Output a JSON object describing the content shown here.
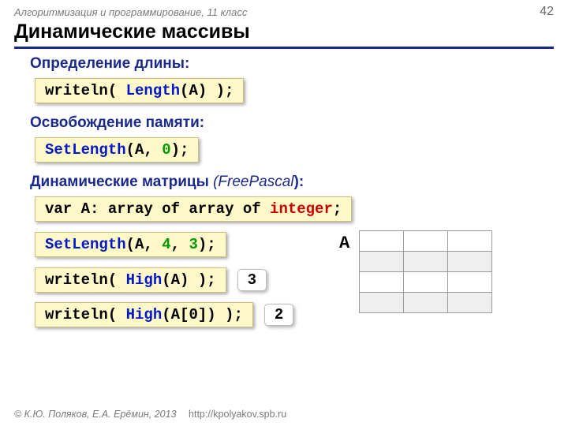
{
  "header": {
    "course": "Алгоритмизация и программирование, 11 класс",
    "page": "42"
  },
  "title": "Динамические массивы",
  "sections": {
    "s1": {
      "heading": "Определение длины:",
      "code": {
        "a": "writeln( ",
        "b": "Length",
        "c": "(A) );"
      }
    },
    "s2": {
      "heading": "Освобождение памяти:",
      "code": {
        "a": "SetLength",
        "b": "(A, ",
        "c": "0",
        "d": ");"
      }
    },
    "s3": {
      "heading_a": "Динамические матрицы",
      "heading_b": " (",
      "heading_c": "FreePascal",
      "heading_d": "):",
      "decl": {
        "a": "var A: array of array of ",
        "b": "integer",
        "c": ";"
      },
      "setlen": {
        "a": "SetLength",
        "b": "(A, ",
        "c": "4",
        "d": ", ",
        "e": "3",
        "f": ");"
      },
      "high1": {
        "a": "writeln( ",
        "b": "High",
        "c": "(A) );",
        "res": "3"
      },
      "high2": {
        "a": "writeln( ",
        "b": "High",
        "c": "(A[0]) );",
        "res": "2"
      },
      "matlabel": "A"
    }
  },
  "footer": {
    "copy": "© К.Ю. Поляков, Е.А. Ерёмин, 2013",
    "url": "http://kpolyakov.spb.ru"
  }
}
